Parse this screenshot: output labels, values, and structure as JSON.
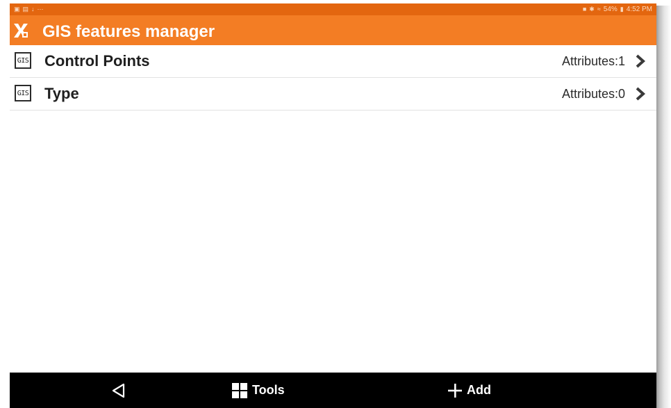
{
  "status_bar": {
    "left_icons": [
      "gallery-icon",
      "cast-icon",
      "download-icon",
      "more-icon"
    ],
    "battery_percent": "54%",
    "time": "4:52 PM"
  },
  "app_bar": {
    "title": "GIS features manager",
    "accent_color": "#f37d24",
    "status_color": "#e3660f"
  },
  "features": [
    {
      "icon_text": "GIS",
      "name": "Control Points",
      "attributes": "Attributes:1"
    },
    {
      "icon_text": "GIS",
      "name": "Type",
      "attributes": "Attributes:0"
    }
  ],
  "nav_bar": {
    "back_icon": "back-triangle-icon",
    "tools_label": "Tools",
    "add_label": "Add"
  }
}
